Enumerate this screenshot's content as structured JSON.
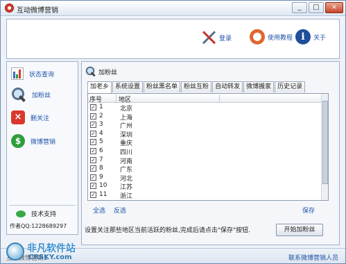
{
  "window": {
    "title": "互动微博营销",
    "min": "_",
    "max": "□",
    "close": "×"
  },
  "toolbar": {
    "login": "登录",
    "tutorial": "使用教程",
    "about": "关于",
    "about_icon_glyph": "i"
  },
  "nav": {
    "items": [
      {
        "label": "状态查询",
        "icon": "chart-icon"
      },
      {
        "label": "加粉丝",
        "icon": "magnifier-icon"
      },
      {
        "label": "删关注",
        "icon": "delete-icon",
        "glyph": "×"
      },
      {
        "label": "微博营销",
        "icon": "dollar-icon",
        "glyph": "$"
      }
    ],
    "support_title": "技术支持",
    "support_qq": "作者QQ:1228689297"
  },
  "main": {
    "section_title": "加粉丝",
    "tabs": [
      "加老乡",
      "系统设置",
      "粉丝黑名单",
      "粉丝互粉",
      "自动转发",
      "微博搬家",
      "历史记录"
    ],
    "active_tab": 0,
    "columns": [
      "序号",
      "地区"
    ],
    "rows": [
      {
        "num": "1",
        "region": "北京",
        "checked": true
      },
      {
        "num": "2",
        "region": "上海",
        "checked": true
      },
      {
        "num": "3",
        "region": "广州",
        "checked": true
      },
      {
        "num": "4",
        "region": "深圳",
        "checked": true
      },
      {
        "num": "5",
        "region": "重庆",
        "checked": true
      },
      {
        "num": "6",
        "region": "四川",
        "checked": true
      },
      {
        "num": "7",
        "region": "河南",
        "checked": true
      },
      {
        "num": "8",
        "region": "广东",
        "checked": true
      },
      {
        "num": "9",
        "region": "河北",
        "checked": true
      },
      {
        "num": "10",
        "region": "江苏",
        "checked": true
      },
      {
        "num": "11",
        "region": "浙江",
        "checked": true
      }
    ],
    "select_all": "全选",
    "invert": "反选",
    "save": "保存",
    "hint": "设置关注那些地区当前活跃的粉丝,完成后请点击\"保存\"按钮.",
    "start_button": "开始加粉丝",
    "check_glyph": "✓"
  },
  "status": {
    "left": "互动微博营销1",
    "right": "联系微博营销人员"
  },
  "watermark": {
    "line1": "非凡软件站",
    "line2": "CRSKY.com"
  }
}
